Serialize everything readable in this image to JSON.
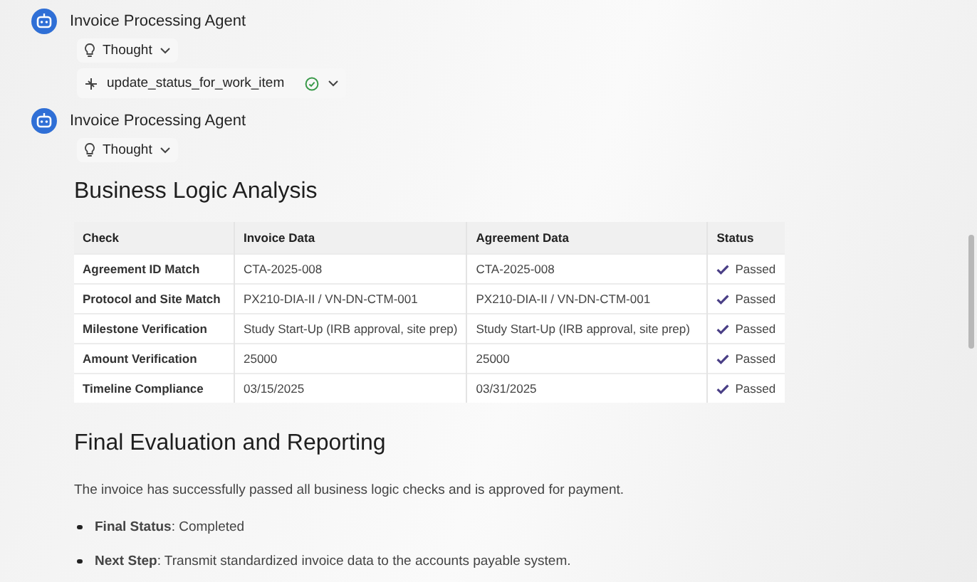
{
  "messages": [
    {
      "agent": "Invoice Processing Agent",
      "steps": [
        {
          "kind": "thought",
          "label": "Thought"
        },
        {
          "kind": "tool",
          "label": "update_status_for_work_item",
          "done": true
        }
      ]
    },
    {
      "agent": "Invoice Processing Agent",
      "steps": [
        {
          "kind": "thought",
          "label": "Thought"
        }
      ],
      "content": {
        "heading": "Business Logic Analysis",
        "table": {
          "columns": [
            "Check",
            "Invoice Data",
            "Agreement Data",
            "Status"
          ],
          "rows": [
            {
              "check": "Agreement ID Match",
              "invoice": "CTA-2025-008",
              "agreement": "CTA-2025-008",
              "status": "Passed"
            },
            {
              "check": "Protocol and Site Match",
              "invoice": "PX210-DIA-II / VN-DN-CTM-001",
              "agreement": "PX210-DIA-II / VN-DN-CTM-001",
              "status": "Passed"
            },
            {
              "check": "Milestone Verification",
              "invoice": "Study Start-Up (IRB approval, site prep)",
              "agreement": "Study Start-Up (IRB approval, site prep)",
              "status": "Passed"
            },
            {
              "check": "Amount Verification",
              "invoice": "25000",
              "agreement": "25000",
              "status": "Passed"
            },
            {
              "check": "Timeline Compliance",
              "invoice": "03/15/2025",
              "agreement": "03/31/2025",
              "status": "Passed"
            }
          ]
        },
        "heading_2": "Final Evaluation and Reporting",
        "paragraph": "The invoice has successfully passed all business logic checks and is approved for payment.",
        "bullets": [
          "**Final Status**: Completed",
          "**Next Step**: Transmit standardized invoice data to the accounts payable system."
        ]
      }
    }
  ]
}
